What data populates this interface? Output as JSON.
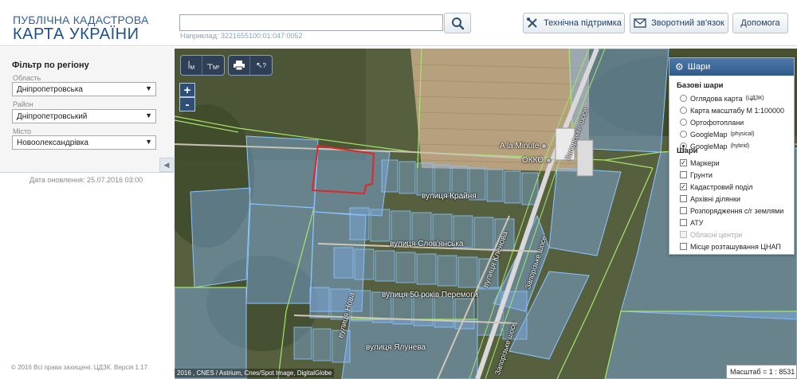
{
  "header": {
    "logo_line1": "ПУБЛІЧНА КАДАСТРОВА",
    "logo_line2": "КАРТА УКРАЇНИ",
    "search": {
      "value": "",
      "hint": "Наприклад: 3221655100:01:047:0052"
    },
    "buttons": {
      "support": "Технічна підтримка",
      "feedback": "Зворотний зв'язок",
      "help": "Допомога"
    }
  },
  "sidebar": {
    "filter_title": "Фільтр по регіону",
    "region_label": "Область",
    "region_value": "Дніпропетровська",
    "district_label": "Район",
    "district_value": "Дніпропетровський",
    "city_label": "Місто",
    "city_value": "Новоолександрівка",
    "update_date": "Дата оновлення: 25.07.2016 03:00",
    "copyright": "© 2016 Всі права захищені. ЦДЗК. Версія 1.17"
  },
  "map": {
    "tools": {
      "ruler": "М",
      "area": "М²",
      "info": "?"
    },
    "zoom_in": "+",
    "zoom_out": "-",
    "labels": {
      "street1": "вулиця Крайня",
      "street2": "вулиця Слов'янська",
      "street3": "вулиця Кленова",
      "street4": "вулиця 50 років Перемоги",
      "street5": "вулиця Нова",
      "street6": "вулиця Ялунева",
      "highway1": "Запорізьке шосе",
      "highway2": "Запорізьке шосе",
      "highway3": "Запорізьке шосе",
      "poi1": "A la Minute",
      "poi2": "ОККО"
    },
    "attribution": "2016 , CNES / Astrium, Cnes/Spot Image, DigitalGlobe",
    "scale": "Масштаб = 1 : 8531",
    "layers": {
      "title": "Шари",
      "base_title": "Базові шари",
      "base": [
        {
          "label": "Оглядова карта",
          "sup": "(ЦДЗК)",
          "selected": false
        },
        {
          "label": "Карта масштабу М 1:100000",
          "sup": "",
          "selected": false
        },
        {
          "label": "Ортофотоплани",
          "sup": "",
          "selected": false
        },
        {
          "label": "GoogleMap",
          "sup": "(physical)",
          "selected": false
        },
        {
          "label": "GoogleMap",
          "sup": "(hybrid)",
          "selected": true
        }
      ],
      "overlay_title": "Шари",
      "overlays": [
        {
          "label": "Маркери",
          "checked": true,
          "disabled": false
        },
        {
          "label": "Грунти",
          "checked": false,
          "disabled": false
        },
        {
          "label": "Кадастровий поділ",
          "checked": true,
          "disabled": false
        },
        {
          "label": "Архівні ділянки",
          "checked": false,
          "disabled": false
        },
        {
          "label": "Розпорядження с/г землями",
          "checked": false,
          "disabled": false
        },
        {
          "label": "АТУ",
          "checked": false,
          "disabled": false
        },
        {
          "label": "Обласні центри",
          "checked": false,
          "disabled": true
        },
        {
          "label": "Місце розташування ЦНАП",
          "checked": false,
          "disabled": false
        }
      ]
    }
  },
  "colors": {
    "brand": "#1f4f8a",
    "parcel_fill": "#7fb0ea",
    "parcel_stroke": "#8cc6ff",
    "selected_parcel": "#e0252b",
    "boundary": "#a6e66a"
  }
}
